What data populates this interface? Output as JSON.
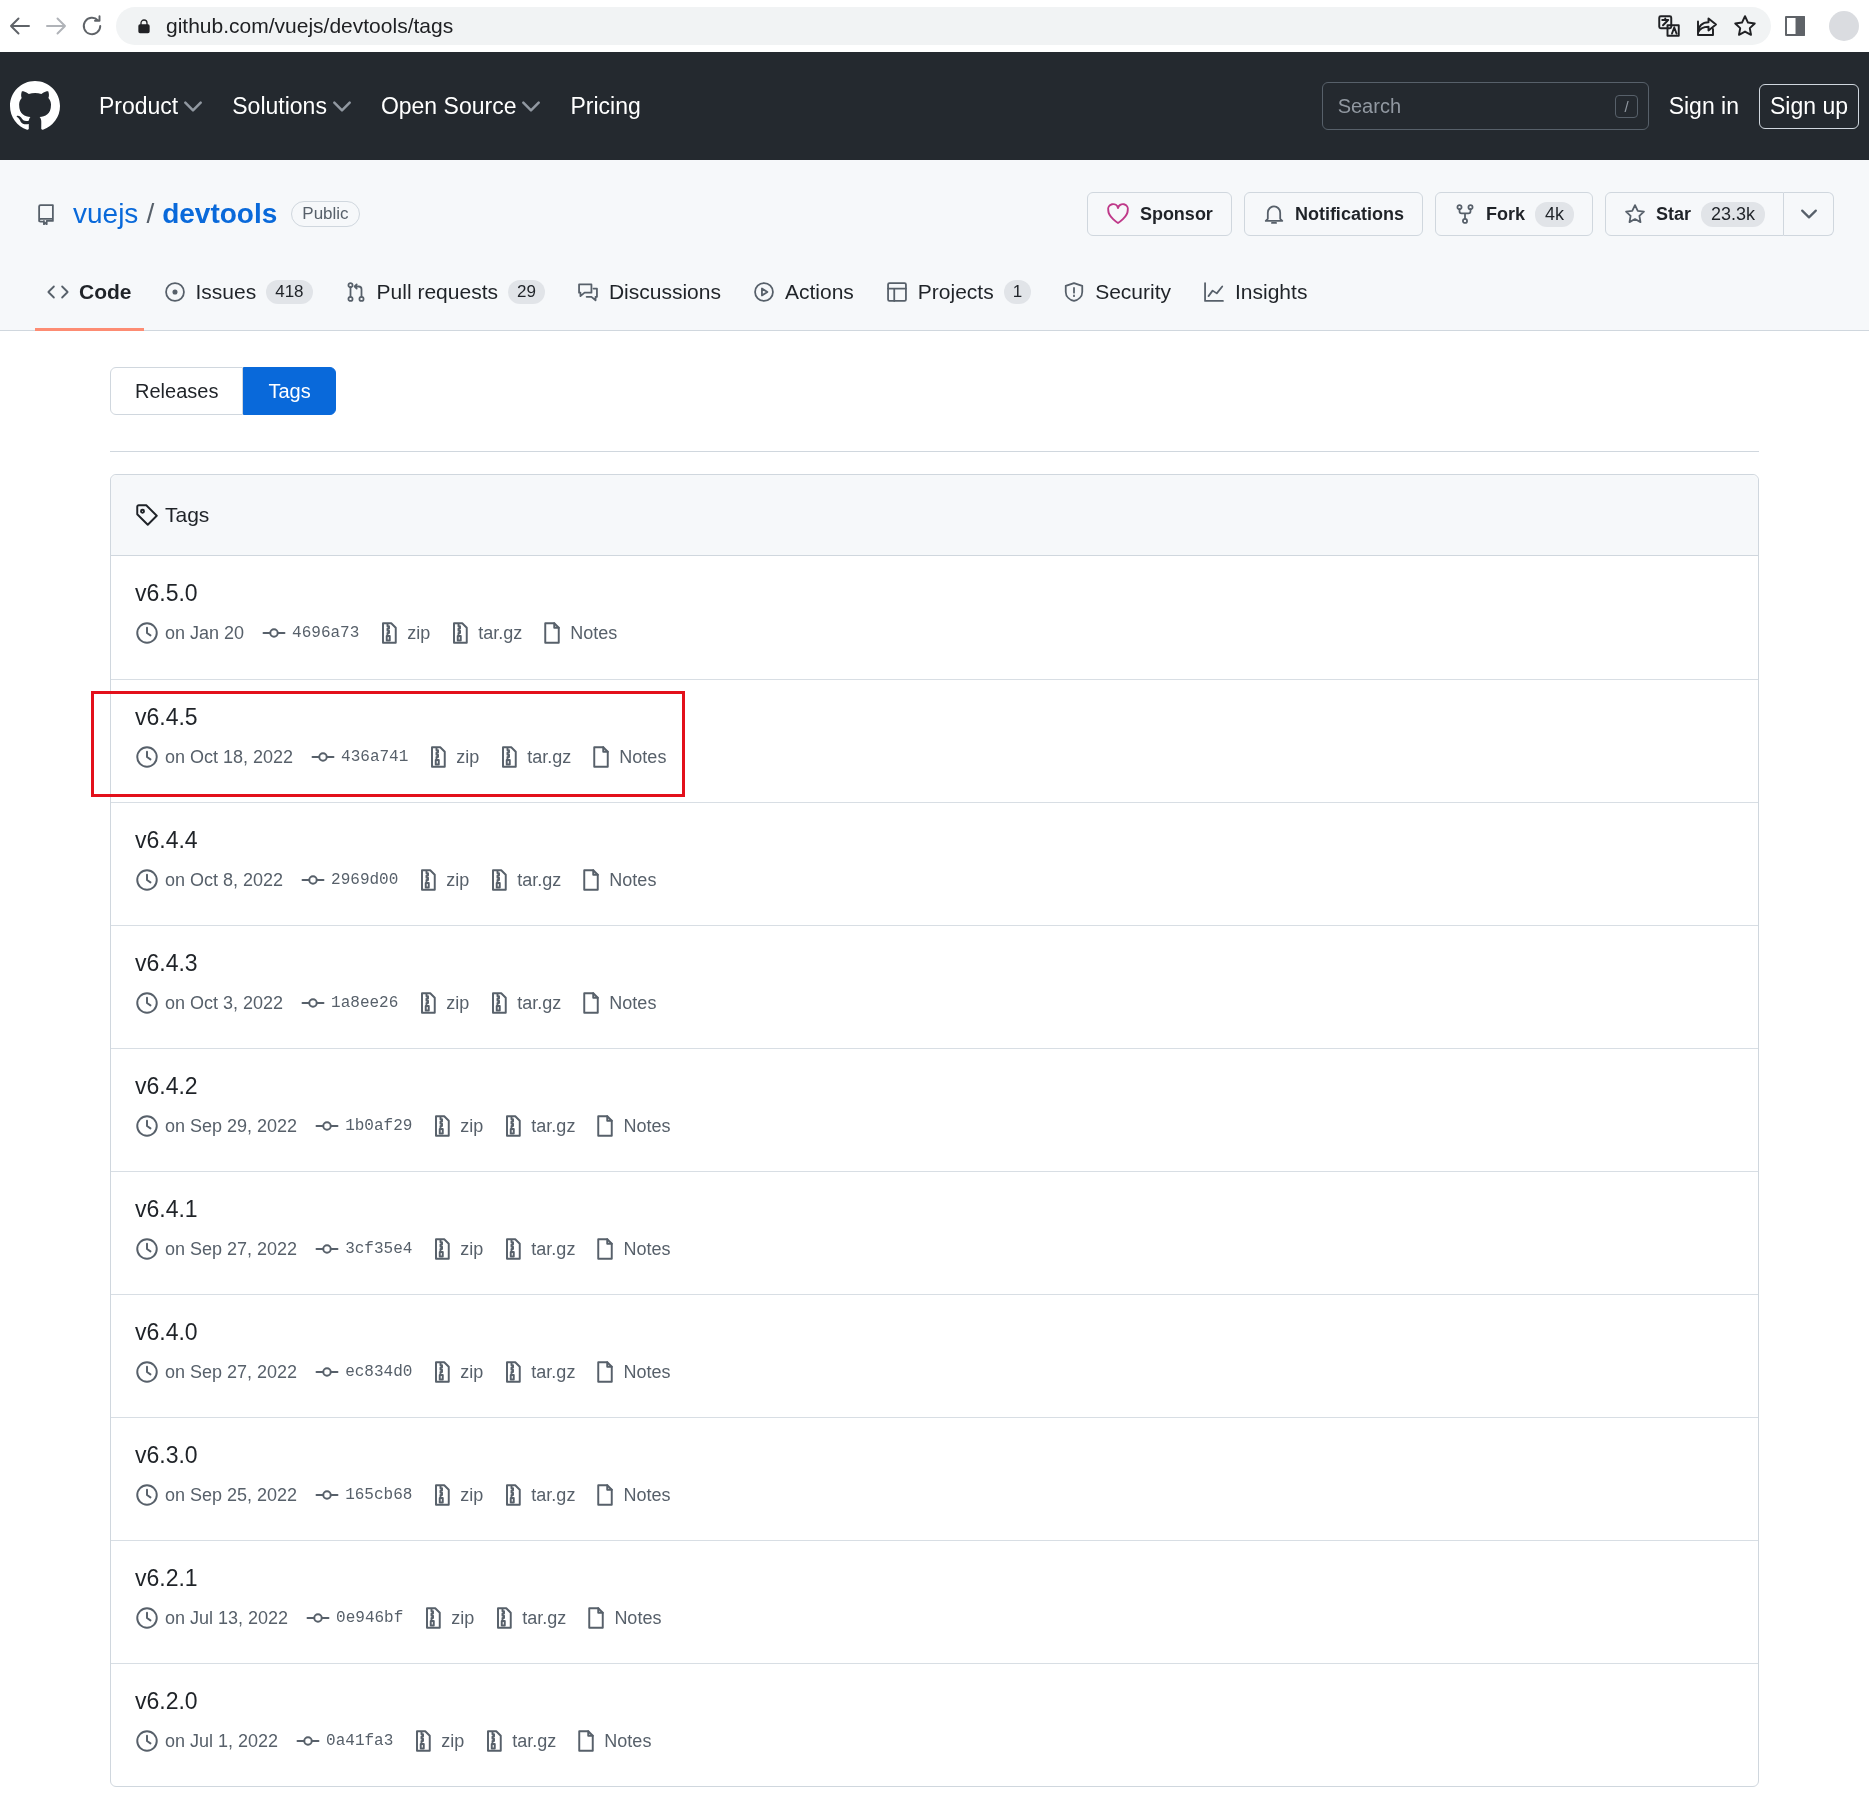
{
  "browser": {
    "url": "github.com/vuejs/devtools/tags"
  },
  "nav": {
    "items": [
      {
        "label": "Product",
        "dropdown": true
      },
      {
        "label": "Solutions",
        "dropdown": true
      },
      {
        "label": "Open Source",
        "dropdown": true
      },
      {
        "label": "Pricing",
        "dropdown": false
      }
    ],
    "search": {
      "placeholder": "Search",
      "shortcut": "/"
    },
    "sign_in": "Sign in",
    "sign_up": "Sign up"
  },
  "repo": {
    "owner": "vuejs",
    "separator": "/",
    "name": "devtools",
    "visibility": "Public",
    "actions": [
      {
        "kind": "sponsor",
        "label": "Sponsor"
      },
      {
        "kind": "notifications",
        "label": "Notifications"
      },
      {
        "kind": "fork",
        "label": "Fork",
        "count": "4k"
      },
      {
        "kind": "star",
        "label": "Star",
        "count": "23.3k"
      }
    ],
    "tabs": [
      {
        "kind": "code",
        "label": "Code",
        "selected": true
      },
      {
        "kind": "issues",
        "label": "Issues",
        "count": "418",
        "selected": false
      },
      {
        "kind": "pulls",
        "label": "Pull requests",
        "count": "29",
        "selected": false
      },
      {
        "kind": "discussions",
        "label": "Discussions",
        "selected": false
      },
      {
        "kind": "actions",
        "label": "Actions",
        "selected": false
      },
      {
        "kind": "projects",
        "label": "Projects",
        "count": "1",
        "selected": false
      },
      {
        "kind": "security",
        "label": "Security",
        "selected": false
      },
      {
        "kind": "insights",
        "label": "Insights",
        "selected": false
      }
    ]
  },
  "subnav": [
    {
      "label": "Releases",
      "selected": false
    },
    {
      "label": "Tags",
      "selected": true
    }
  ],
  "tags": {
    "title": "Tags",
    "rows": [
      {
        "name": "v6.5.0",
        "date": "on Jan 20",
        "commit": "4696a73",
        "zip": "zip",
        "tarball": "tar.gz",
        "notes": "Notes",
        "highlighted": false
      },
      {
        "name": "v6.4.5",
        "date": "on Oct 18, 2022",
        "commit": "436a741",
        "zip": "zip",
        "tarball": "tar.gz",
        "notes": "Notes",
        "highlighted": true
      },
      {
        "name": "v6.4.4",
        "date": "on Oct 8, 2022",
        "commit": "2969d00",
        "zip": "zip",
        "tarball": "tar.gz",
        "notes": "Notes",
        "highlighted": false
      },
      {
        "name": "v6.4.3",
        "date": "on Oct 3, 2022",
        "commit": "1a8ee26",
        "zip": "zip",
        "tarball": "tar.gz",
        "notes": "Notes",
        "highlighted": false
      },
      {
        "name": "v6.4.2",
        "date": "on Sep 29, 2022",
        "commit": "1b0af29",
        "zip": "zip",
        "tarball": "tar.gz",
        "notes": "Notes",
        "highlighted": false
      },
      {
        "name": "v6.4.1",
        "date": "on Sep 27, 2022",
        "commit": "3cf35e4",
        "zip": "zip",
        "tarball": "tar.gz",
        "notes": "Notes",
        "highlighted": false
      },
      {
        "name": "v6.4.0",
        "date": "on Sep 27, 2022",
        "commit": "ec834d0",
        "zip": "zip",
        "tarball": "tar.gz",
        "notes": "Notes",
        "highlighted": false
      },
      {
        "name": "v6.3.0",
        "date": "on Sep 25, 2022",
        "commit": "165cb68",
        "zip": "zip",
        "tarball": "tar.gz",
        "notes": "Notes",
        "highlighted": false
      },
      {
        "name": "v6.2.1",
        "date": "on Jul 13, 2022",
        "commit": "0e946bf",
        "zip": "zip",
        "tarball": "tar.gz",
        "notes": "Notes",
        "highlighted": false
      },
      {
        "name": "v6.2.0",
        "date": "on Jul 1, 2022",
        "commit": "0a41fa3",
        "zip": "zip",
        "tarball": "tar.gz",
        "notes": "Notes",
        "highlighted": false
      }
    ]
  }
}
